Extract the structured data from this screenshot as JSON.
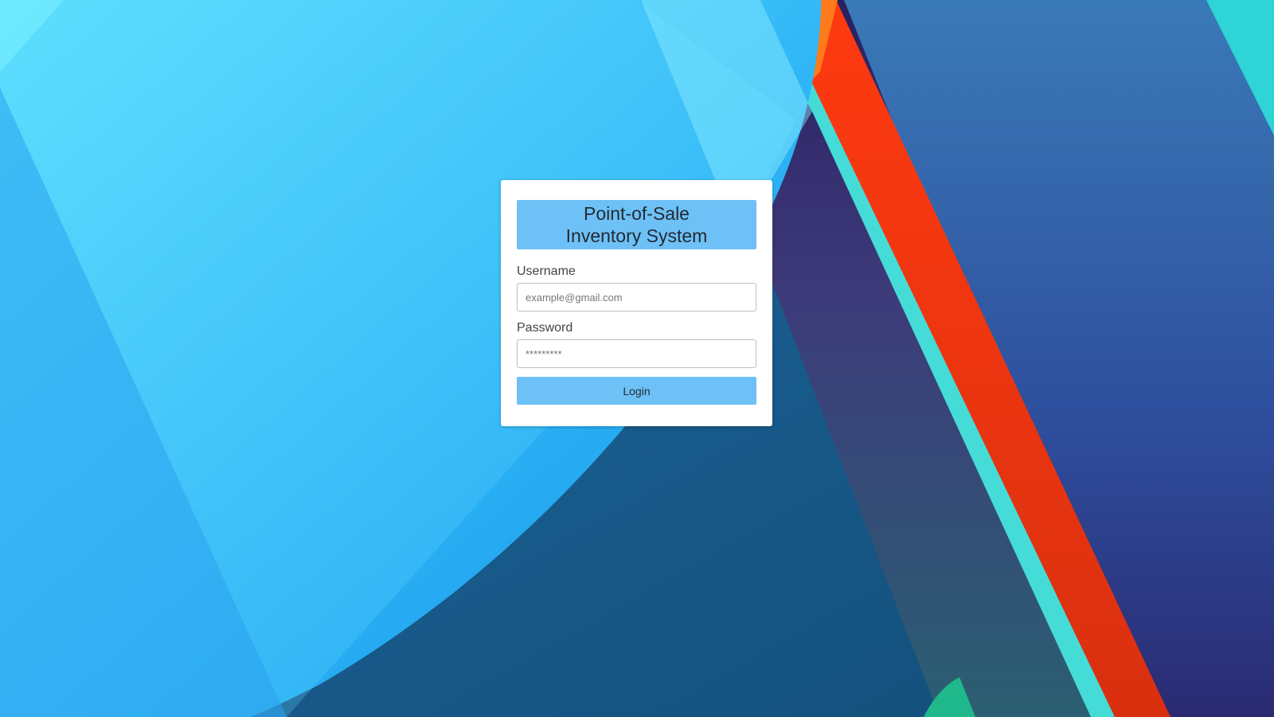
{
  "app": {
    "title_line1": "Point-of-Sale",
    "title_line2": "Inventory System"
  },
  "form": {
    "username_label": "Username",
    "username_placeholder": "example@gmail.com",
    "username_value": "",
    "password_label": "Password",
    "password_placeholder": "*********",
    "password_value": "",
    "login_label": "Login"
  },
  "colors": {
    "accent": "#6ec1f7",
    "card": "#ffffff",
    "text_dark": "#222a33",
    "label": "#444444"
  },
  "background": {
    "description_icon": "abstract-material-wallpaper"
  }
}
